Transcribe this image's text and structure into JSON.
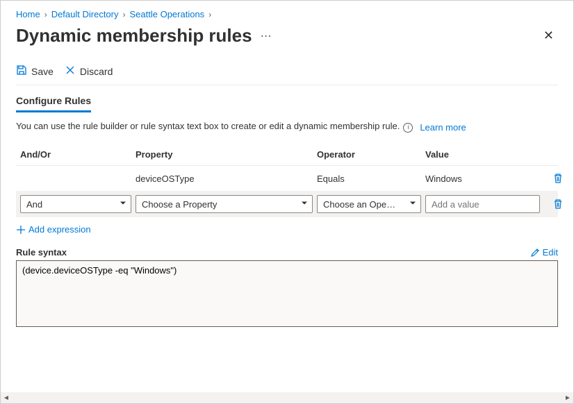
{
  "breadcrumb": {
    "items": [
      "Home",
      "Default Directory",
      "Seattle Operations"
    ]
  },
  "page": {
    "title": "Dynamic membership rules"
  },
  "toolbar": {
    "save_label": "Save",
    "discard_label": "Discard"
  },
  "tabs": {
    "configure_label": "Configure Rules"
  },
  "helper": {
    "text": "You can use the rule builder or rule syntax text box to create or edit a dynamic membership rule.",
    "learn_more_label": "Learn more"
  },
  "table": {
    "headers": {
      "andor": "And/Or",
      "property": "Property",
      "operator": "Operator",
      "value": "Value"
    },
    "rows": [
      {
        "andor": "",
        "property": "deviceOSType",
        "operator": "Equals",
        "value": "Windows",
        "editable": false
      },
      {
        "andor": "And",
        "property_placeholder": "Choose a Property",
        "operator_placeholder": "Choose an Ope…",
        "value_placeholder": "Add a value",
        "editable": true
      }
    ],
    "add_expression_label": "Add expression"
  },
  "rule_syntax": {
    "label": "Rule syntax",
    "edit_label": "Edit",
    "value": "(device.deviceOSType -eq \"Windows\")"
  }
}
